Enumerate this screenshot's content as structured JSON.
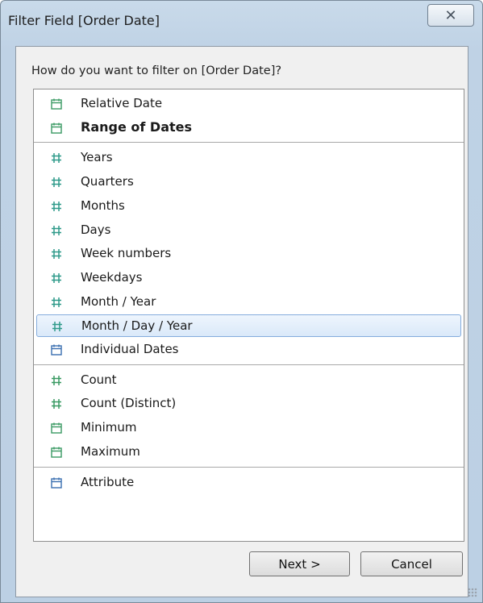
{
  "window": {
    "title": "Filter Field [Order Date]",
    "close_glyph": "✕"
  },
  "prompt": "How do you want to filter on [Order Date]?",
  "groups": [
    {
      "items": [
        {
          "label": "Relative Date",
          "icon": "calendar-icon",
          "color": "#3a9a63",
          "bold": false
        },
        {
          "label": "Range of Dates",
          "icon": "calendar-icon",
          "color": "#3a9a63",
          "bold": true
        }
      ]
    },
    {
      "items": [
        {
          "label": "Years",
          "icon": "hash-icon",
          "color": "#2f9a8a"
        },
        {
          "label": "Quarters",
          "icon": "hash-icon",
          "color": "#2f9a8a"
        },
        {
          "label": "Months",
          "icon": "hash-icon",
          "color": "#2f9a8a"
        },
        {
          "label": "Days",
          "icon": "hash-icon",
          "color": "#2f9a8a"
        },
        {
          "label": "Week numbers",
          "icon": "hash-icon",
          "color": "#2f9a8a"
        },
        {
          "label": "Weekdays",
          "icon": "hash-icon",
          "color": "#2f9a8a"
        },
        {
          "label": "Month / Year",
          "icon": "hash-icon",
          "color": "#2f9a8a"
        },
        {
          "label": "Month / Day / Year",
          "icon": "hash-icon",
          "color": "#2f9a8a",
          "selected": true
        },
        {
          "label": "Individual Dates",
          "icon": "calendar-icon",
          "color": "#3a6fb0"
        }
      ]
    },
    {
      "items": [
        {
          "label": "Count",
          "icon": "hash-icon",
          "color": "#3a9a63"
        },
        {
          "label": "Count (Distinct)",
          "icon": "hash-icon",
          "color": "#3a9a63"
        },
        {
          "label": "Minimum",
          "icon": "calendar-icon",
          "color": "#3a9a63"
        },
        {
          "label": "Maximum",
          "icon": "calendar-icon",
          "color": "#3a9a63"
        }
      ]
    },
    {
      "items": [
        {
          "label": "Attribute",
          "icon": "calendar-icon",
          "color": "#3a6fb0"
        }
      ]
    }
  ],
  "buttons": {
    "next": "Next >",
    "cancel": "Cancel"
  }
}
